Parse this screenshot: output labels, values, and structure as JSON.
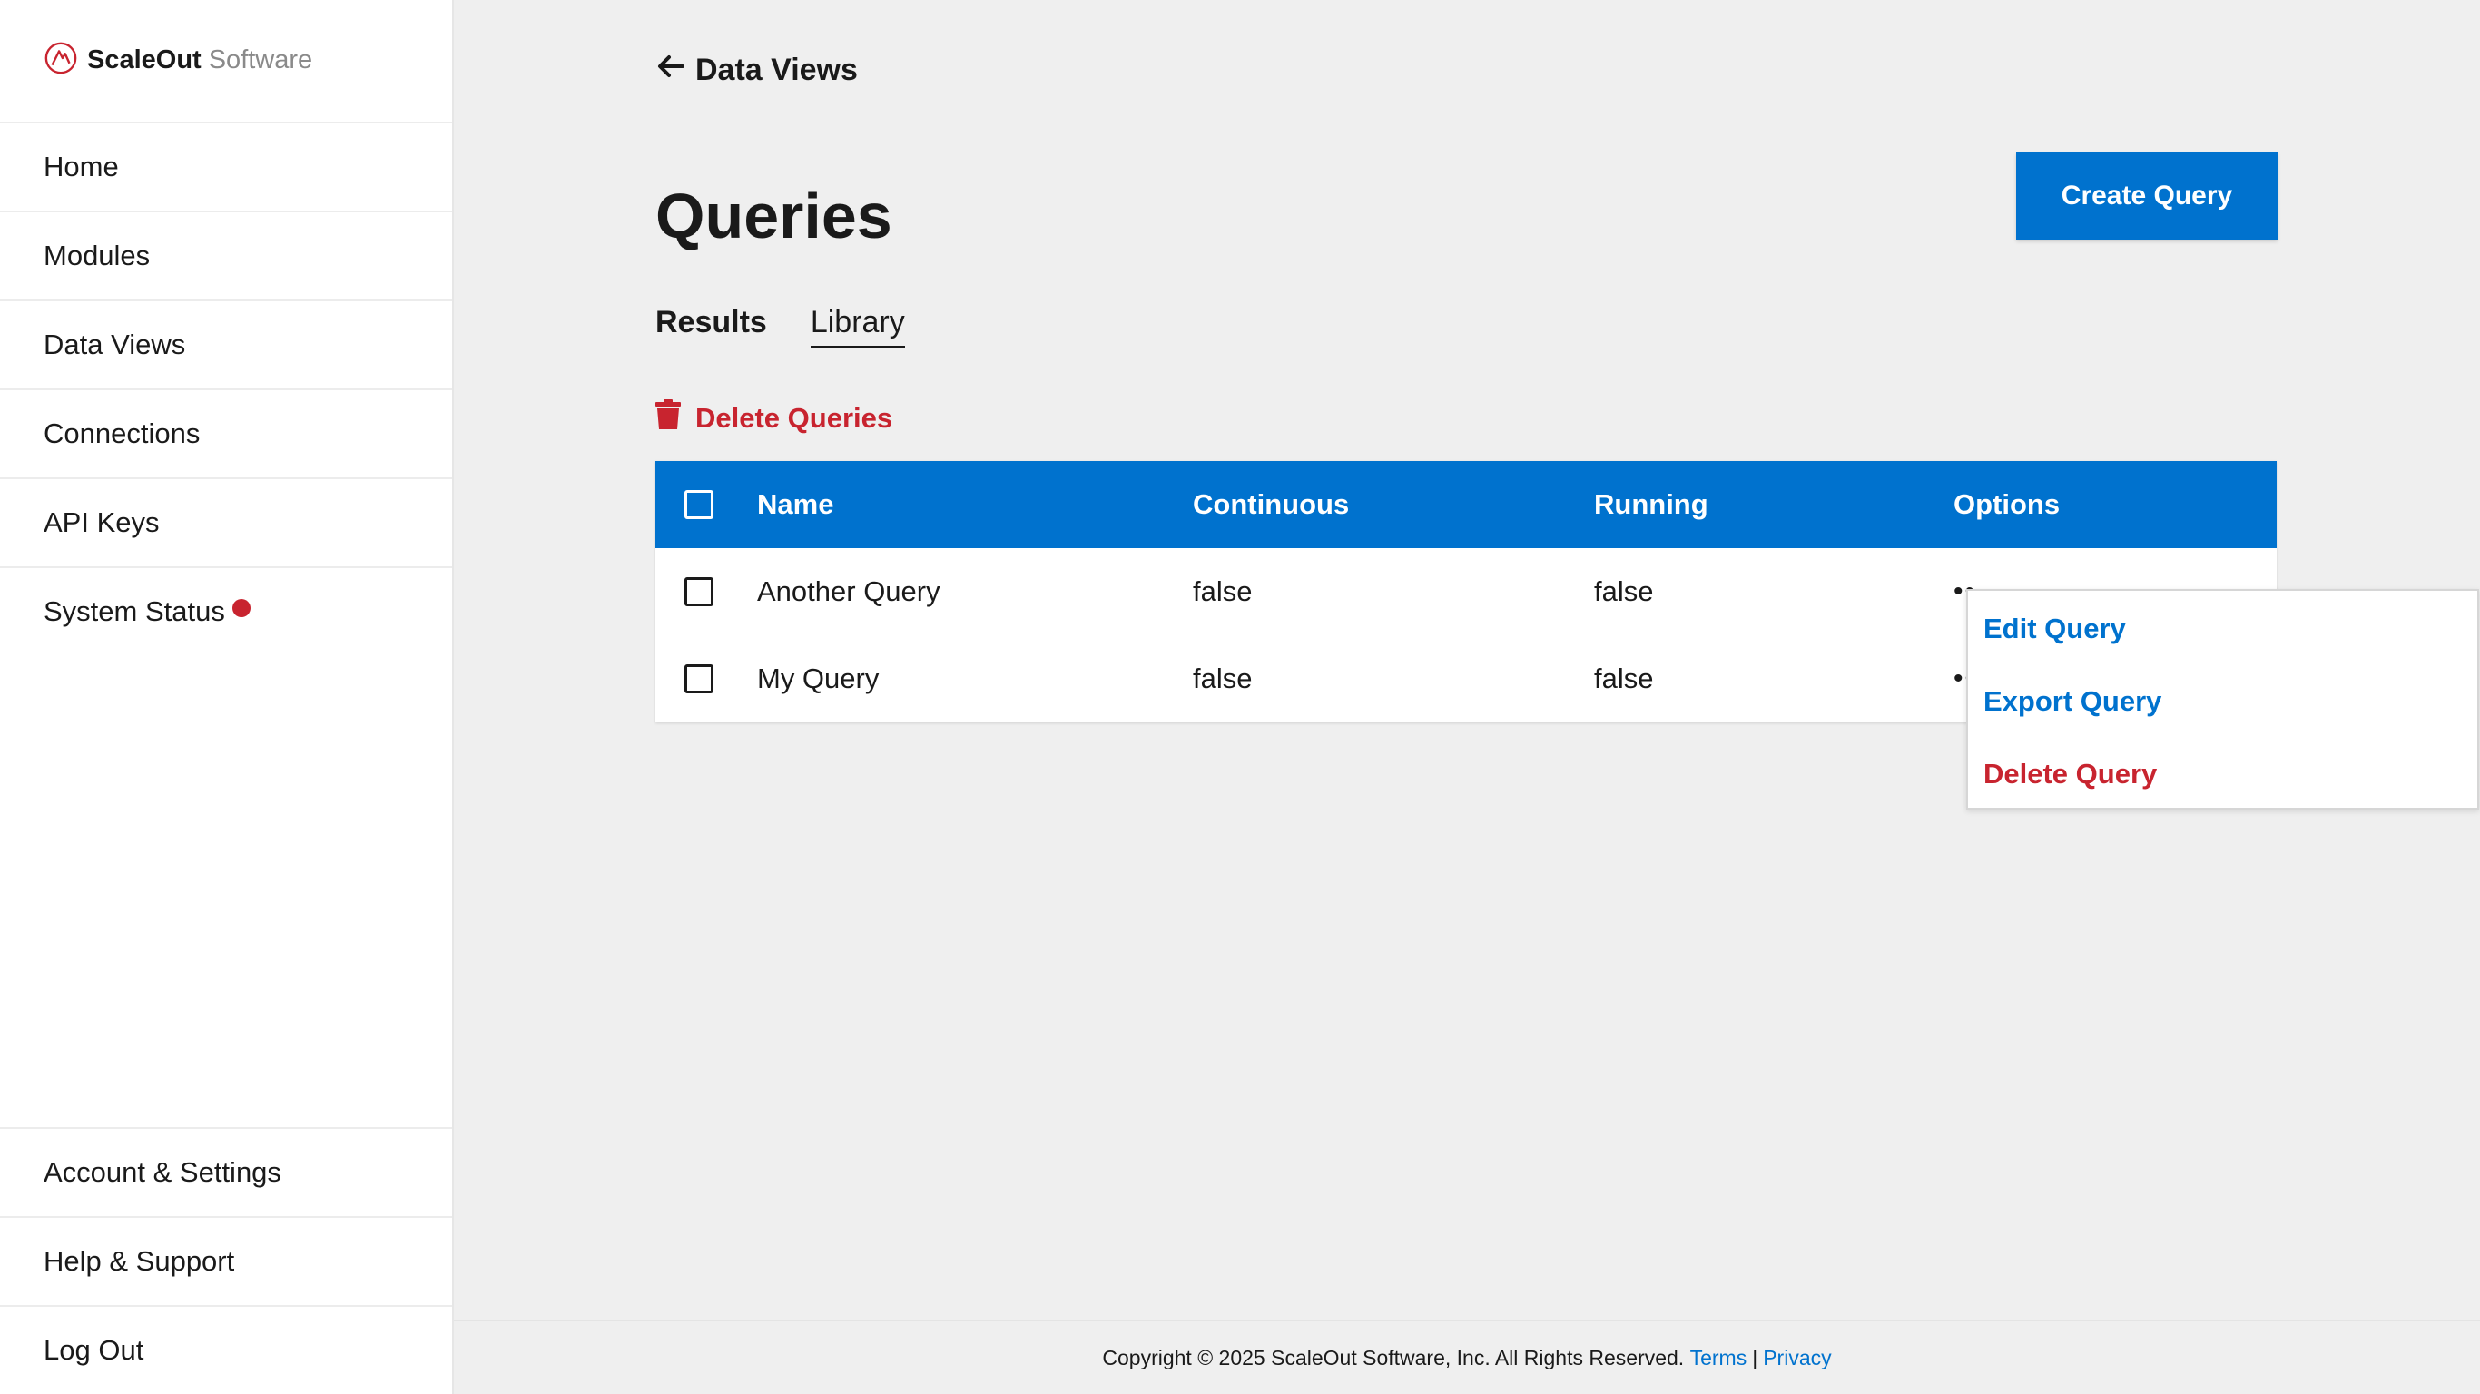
{
  "brand": {
    "name": "ScaleOut",
    "suffix": "Software",
    "logo_icon": "scaleout-logo-icon"
  },
  "sidebar": {
    "items": [
      {
        "label": "Home"
      },
      {
        "label": "Modules"
      },
      {
        "label": "Data Views"
      },
      {
        "label": "Connections"
      },
      {
        "label": "API Keys"
      },
      {
        "label": "System Status",
        "status_color": "#c8242f"
      }
    ],
    "bottom_items": [
      {
        "label": "Account & Settings"
      },
      {
        "label": "Help & Support"
      },
      {
        "label": "Log Out"
      }
    ]
  },
  "header": {
    "back_label": "Data Views",
    "back_icon": "arrow-left-icon",
    "title": "Queries",
    "create_button": "Create Query"
  },
  "tabs": [
    {
      "label": "Results",
      "active": false
    },
    {
      "label": "Library",
      "active": true
    }
  ],
  "actions": {
    "delete_label": "Delete Queries",
    "delete_icon": "trash-icon"
  },
  "table": {
    "columns": [
      "Name",
      "Continuous",
      "Running",
      "Options"
    ],
    "rows": [
      {
        "name": "Another Query",
        "continuous": "false",
        "running": "false",
        "options": "••"
      },
      {
        "name": "My Query",
        "continuous": "false",
        "running": "false",
        "options": "••"
      }
    ]
  },
  "options_menu": {
    "items": [
      {
        "label": "Edit Query"
      },
      {
        "label": "Export Query"
      },
      {
        "label": "Delete Query"
      }
    ]
  },
  "footer": {
    "copyright": "Copyright © 2025 ScaleOut Software, Inc. All Rights Reserved.",
    "terms": "Terms",
    "separator": "|",
    "privacy": "Privacy"
  },
  "colors": {
    "accent": "#0072ce",
    "danger": "#c8242f",
    "background": "#efefef"
  }
}
